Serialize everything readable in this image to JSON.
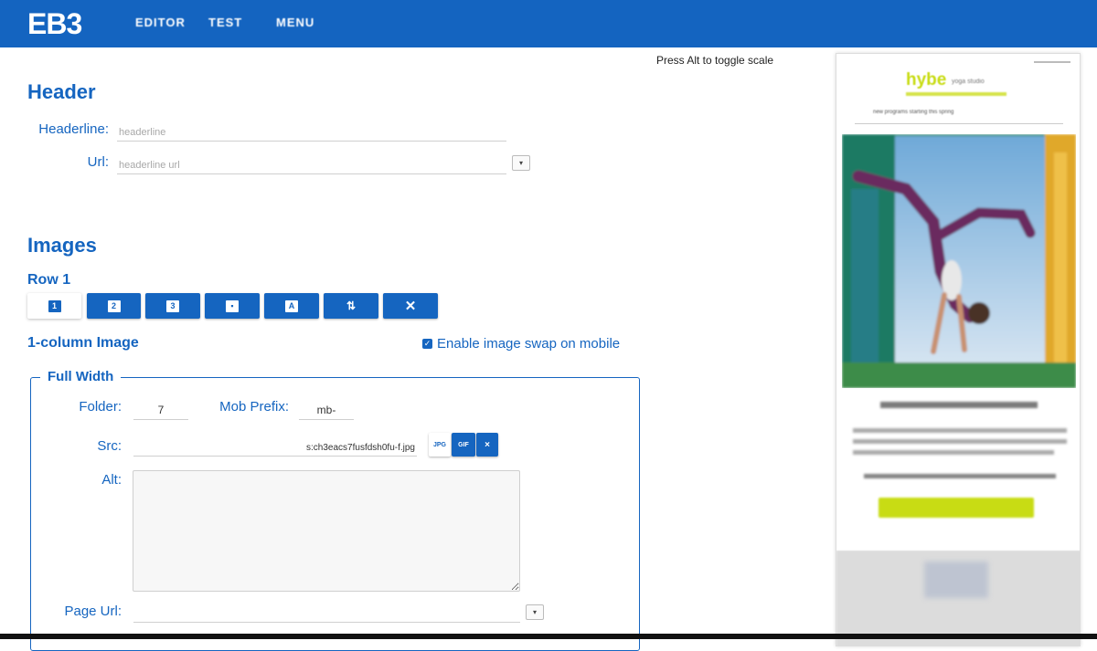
{
  "app": {
    "logo": "EB3",
    "nav": [
      "EDITOR",
      "TEST",
      "MENU"
    ],
    "hint": "Press Alt to toggle scale"
  },
  "header_section": {
    "title": "Header",
    "headline_label": "Headerline:",
    "headline_placeholder": "headerline",
    "url_label": "Url:",
    "url_placeholder": "headerline url",
    "dropdown_glyph": "▾"
  },
  "images_section": {
    "title": "Images",
    "row_title": "Row 1",
    "toolbar_buttons": [
      "1",
      "2",
      "3",
      "▪",
      "A",
      "⇅",
      "✕"
    ],
    "layout_title": "1-column Image",
    "swap_label": "Enable image swap on mobile",
    "swap_checked": true
  },
  "full_width": {
    "legend": "Full Width",
    "folder_label": "Folder:",
    "folder_value": "7",
    "mob_prefix_label": "Mob Prefix:",
    "mob_prefix_value": "mb-",
    "src_label": "Src:",
    "src_value": "s:ch3eacs7fusfdsh0fu-f.jpg",
    "format_buttons": [
      "JPG",
      "GIF",
      "×"
    ],
    "alt_label": "Alt:",
    "alt_value": "",
    "page_url_label": "Page Url:",
    "page_url_value": "",
    "dropdown_glyph": "▾"
  },
  "preview": {
    "brand": "hybe",
    "brand_sub": "yoga studio",
    "tagline": "new programs starting this spring"
  },
  "colors": {
    "primary": "#1464c0",
    "accent_lime": "#c8dc14"
  }
}
